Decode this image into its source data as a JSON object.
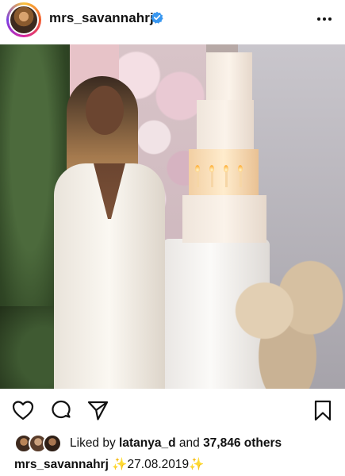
{
  "header": {
    "username": "mrs_savannahrj",
    "verified_icon": "verified-badge-icon",
    "more_icon": "more-options-icon"
  },
  "post": {
    "image_alt_subject": "woman in white standing next to a tiered birthday cake"
  },
  "actions": {
    "like_icon": "heart-icon",
    "comment_icon": "comment-icon",
    "share_icon": "send-icon",
    "save_icon": "bookmark-icon"
  },
  "likes": {
    "prefix": "Liked by",
    "first_liker": "latanya_d",
    "connector": "and",
    "others": "37,846 others"
  },
  "caption": {
    "username": "mrs_savannahrj",
    "sparkle_left": "✨",
    "date": "27.08.2019",
    "sparkle_right": "✨"
  },
  "colors": {
    "verified_blue": "#3897f0",
    "text": "#111111",
    "sparkle": "#e8b400"
  }
}
